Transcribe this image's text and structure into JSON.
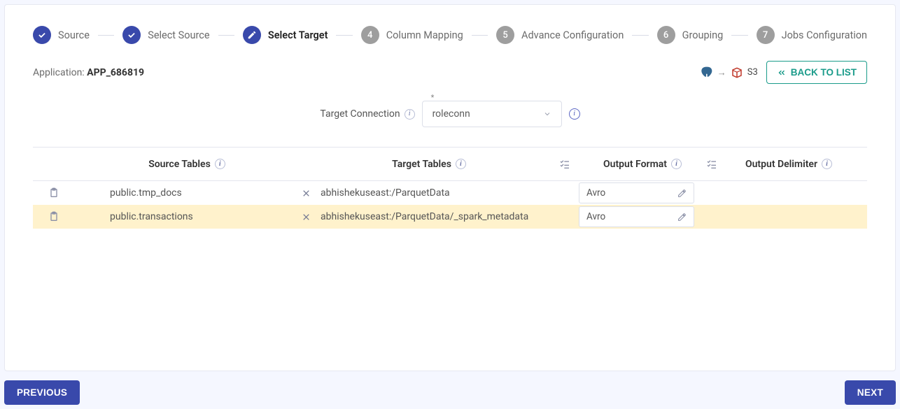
{
  "stepper": [
    {
      "label": "Source",
      "state": "done"
    },
    {
      "label": "Select Source",
      "state": "done"
    },
    {
      "label": "Select Target",
      "state": "active"
    },
    {
      "num": "4",
      "label": "Column Mapping",
      "state": "todo"
    },
    {
      "num": "5",
      "label": "Advance Configuration",
      "state": "todo"
    },
    {
      "num": "6",
      "label": "Grouping",
      "state": "todo"
    },
    {
      "num": "7",
      "label": "Jobs Configuration",
      "state": "todo"
    }
  ],
  "application": {
    "prefix": "Application: ",
    "name": "APP_686819"
  },
  "dest_label": "S3",
  "back_button": "BACK TO LIST",
  "target_connection": {
    "label": "Target Connection",
    "value": "roleconn"
  },
  "table": {
    "headers": {
      "source": "Source Tables",
      "target": "Target Tables",
      "format": "Output Format",
      "delimiter": "Output Delimiter"
    },
    "rows": [
      {
        "source": "public.tmp_docs",
        "target": "abhishekuseast:/ParquetData",
        "format": "Avro",
        "highlight": false
      },
      {
        "source": "public.transactions",
        "target": "abhishekuseast:/ParquetData/_spark_metadata",
        "format": "Avro",
        "highlight": true
      }
    ]
  },
  "buttons": {
    "previous": "PREVIOUS",
    "next": "NEXT"
  }
}
